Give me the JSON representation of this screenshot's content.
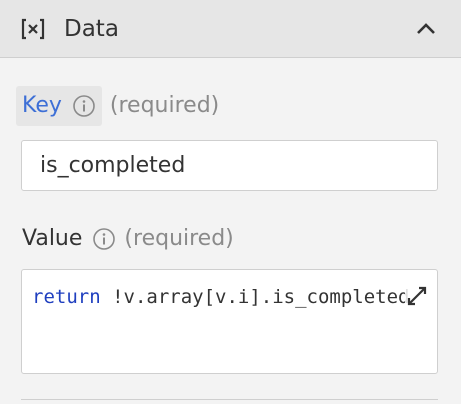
{
  "header": {
    "icon": "variable-icon",
    "title": "Data",
    "collapse_icon": "chevron-up-icon"
  },
  "key_field": {
    "label": "Key",
    "info_icon": "info-icon",
    "required": "(required)",
    "value": "is_completed"
  },
  "value_field": {
    "label": "Value",
    "info_icon": "info-icon",
    "required": "(required)",
    "code_keyword": "return",
    "code_rest": " !v.array[v.i].is_completed",
    "expand_icon": "expand-icon"
  },
  "colors": {
    "key_label": "#3d6fd6",
    "code_keyword": "#1f3fbf",
    "header_bg": "#e6e6e6",
    "panel_bg": "#f3f3f3"
  }
}
